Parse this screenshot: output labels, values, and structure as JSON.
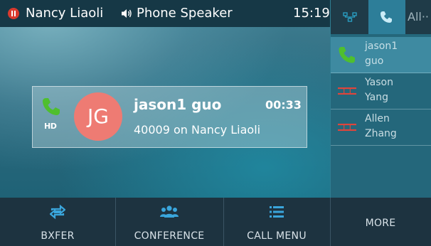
{
  "topbar": {
    "account": "Nancy Liaoli",
    "audio_mode": "Phone Speaker",
    "time": "15:19"
  },
  "call": {
    "hd_badge": "HD",
    "avatar_initials": "JG",
    "name": "jason1 guo",
    "duration": "00:33",
    "info": "40009  on Nancy Liaoli"
  },
  "softkeys": [
    {
      "label": "BXFER",
      "icon": "transfer-icon"
    },
    {
      "label": "CONFERENCE",
      "icon": "conference-icon"
    },
    {
      "label": "CALL MENU",
      "icon": "menu-list-icon"
    },
    {
      "label": "MORE"
    }
  ],
  "side_panel": {
    "tabs": [
      {
        "icon": "network-icon"
      },
      {
        "icon": "call-tab-icon",
        "active": true
      },
      {
        "label": "All··"
      }
    ],
    "items": [
      {
        "first": "jason1",
        "last": "guo",
        "icon": "green-phone-icon",
        "active": true
      },
      {
        "first": "Yason",
        "last": "Yang",
        "icon": "blf-idle-icon"
      },
      {
        "first": "Allen",
        "last": "Zhang",
        "icon": "blf-idle-icon"
      }
    ]
  },
  "colors": {
    "accent_green": "#4fbf2e",
    "avatar_bg": "#ee7b73",
    "line_status_red": "#d93a2e",
    "blf_red": "#e0453b"
  }
}
